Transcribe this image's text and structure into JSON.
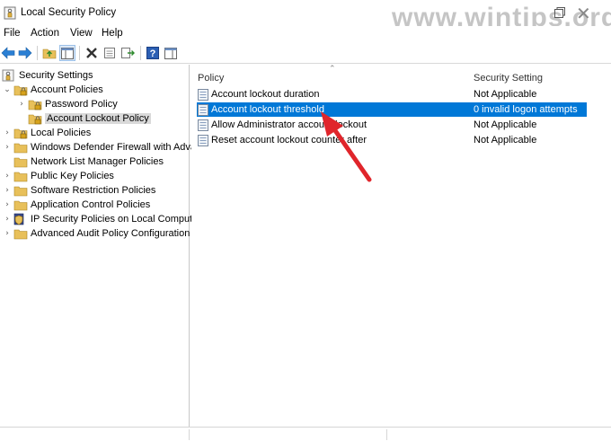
{
  "window": {
    "title": "Local Security Policy",
    "watermark": "www.wintips.org"
  },
  "menu": {
    "items": [
      "File",
      "Action",
      "View",
      "Help"
    ]
  },
  "toolbar": {
    "buttons": [
      "back-icon",
      "forward-icon",
      "up-folder-icon",
      "show-hide-tree-icon",
      "delete-icon",
      "properties-icon",
      "export-list-icon",
      "help-icon",
      "action-pane-icon"
    ]
  },
  "tree": {
    "root": "Security Settings",
    "items": [
      {
        "label": "Account Policies",
        "level": 1,
        "expanded": true
      },
      {
        "label": "Password Policy",
        "level": 2
      },
      {
        "label": "Account Lockout Policy",
        "level": 2,
        "selected": true
      },
      {
        "label": "Local Policies",
        "level": 1
      },
      {
        "label": "Windows Defender Firewall with Advar",
        "level": 1
      },
      {
        "label": "Network List Manager Policies",
        "level": 1
      },
      {
        "label": "Public Key Policies",
        "level": 1
      },
      {
        "label": "Software Restriction Policies",
        "level": 1
      },
      {
        "label": "Application Control Policies",
        "level": 1
      },
      {
        "label": "IP Security Policies on Local Computer",
        "level": 1
      },
      {
        "label": "Advanced Audit Policy Configuration",
        "level": 1
      }
    ]
  },
  "list": {
    "columns": {
      "policy": "Policy",
      "setting": "Security Setting"
    },
    "rows": [
      {
        "policy": "Account lockout duration",
        "setting": "Not Applicable"
      },
      {
        "policy": "Account lockout threshold",
        "setting": "0 invalid logon attempts",
        "selected": true
      },
      {
        "policy": "Allow Administrator account lockout",
        "setting": "Not Applicable"
      },
      {
        "policy": "Reset account lockout counter after",
        "setting": "Not Applicable"
      }
    ]
  },
  "colors": {
    "selection": "#0078d7",
    "annotation_arrow": "#e0252b",
    "folder": "#e8c05a"
  }
}
